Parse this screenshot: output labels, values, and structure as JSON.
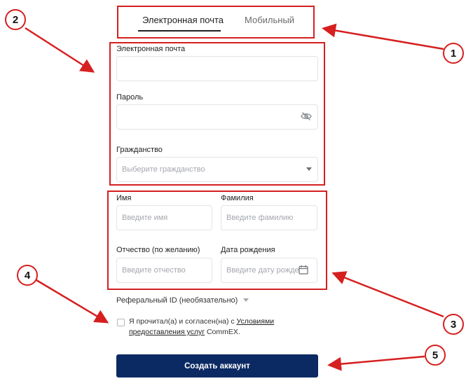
{
  "tabs": {
    "email": "Электронная почта",
    "mobile": "Мобильный"
  },
  "fields": {
    "email_label": "Электронная почта",
    "password_label": "Пароль",
    "citizenship_label": "Гражданство",
    "citizenship_placeholder": "Выберите гражданство",
    "first_name_label": "Имя",
    "first_name_placeholder": "Введите имя",
    "last_name_label": "Фамилия",
    "last_name_placeholder": "Введите фамилию",
    "patronymic_label": "Отчество (по желанию)",
    "patronymic_placeholder": "Введите отчество",
    "birthdate_label": "Дата рождения",
    "birthdate_placeholder": "Введите дату рожде"
  },
  "referral": {
    "label": "Реферальный ID (необязательно)"
  },
  "consent": {
    "prefix": "Я прочитал(а) и согласен(на) с ",
    "link": "Условиями предоставления услуг",
    "suffix": " CommEX."
  },
  "submit_label": "Создать аккаунт",
  "annotations": [
    "1",
    "2",
    "3",
    "4",
    "5"
  ],
  "colors": {
    "annotation_red": "#d61f1f",
    "button_navy": "#0b2a63"
  },
  "icons": [
    "eye-off-icon",
    "dropdown-caret-icon",
    "calendar-icon",
    "chevron-down-icon"
  ]
}
